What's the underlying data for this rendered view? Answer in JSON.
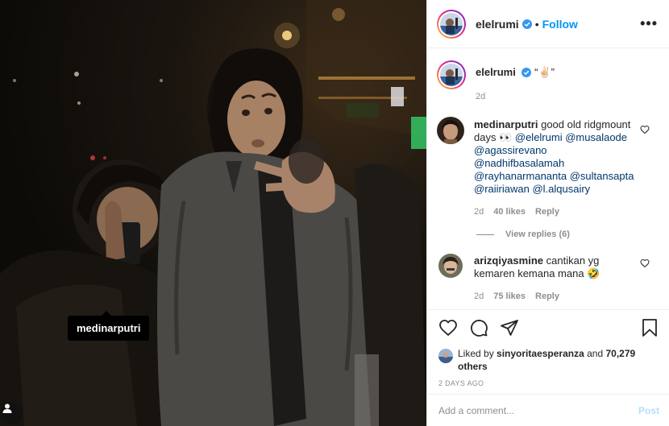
{
  "photo": {
    "tagged_user": "medinarputri"
  },
  "header": {
    "username": "elelrumi",
    "follow_label": "Follow",
    "separator": "•",
    "more_label": "•••"
  },
  "caption": {
    "username": "elelrumi",
    "text": "“✌🏻”",
    "time": "2d"
  },
  "comments": [
    {
      "username": "medinarputri",
      "text_before": "good old ridgmount days 👀 ",
      "mentions": [
        "@elelrumi",
        "@musalaode",
        "@agassirevano",
        "@nadhifbasalamah",
        "@rayhanarmananta",
        "@sultansapta",
        "@raiiriawan",
        "@l.alqusairy"
      ],
      "time": "2d",
      "likes": "40 likes",
      "reply_label": "Reply",
      "view_replies": "View replies (6)"
    },
    {
      "username": "arizqiyasmine",
      "text": "cantikan yg kemaren kemana mana 🤣",
      "time": "2d",
      "likes": "75 likes",
      "reply_label": "Reply"
    }
  ],
  "likes": {
    "prefix": "Liked by",
    "user": "sinyoritaesperanza",
    "joiner": "and",
    "others": "70,279 others"
  },
  "timestamp": "2 DAYS AGO",
  "add_comment": {
    "placeholder": "Add a comment...",
    "post_label": "Post"
  },
  "colors": {
    "link": "#0095f6",
    "mention": "#00376b",
    "muted": "#8e8e8e",
    "post_disabled": "#b2dffc"
  }
}
